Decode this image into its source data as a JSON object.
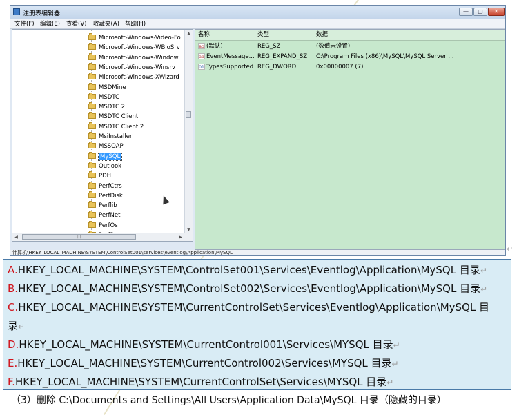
{
  "window": {
    "title": "注册表编辑器",
    "menu": [
      "文件(F)",
      "编辑(E)",
      "查看(V)",
      "收藏夹(A)",
      "帮助(H)"
    ]
  },
  "tree": {
    "items": [
      {
        "label": "Microsoft-Windows-Video-Fo",
        "selected": false
      },
      {
        "label": "Microsoft-Windows-WBioSrv",
        "selected": false
      },
      {
        "label": "Microsoft-Windows-Window",
        "selected": false
      },
      {
        "label": "Microsoft-Windows-Winsrv",
        "selected": false
      },
      {
        "label": "Microsoft-Windows-XWizard",
        "selected": false
      },
      {
        "label": "MSDMine",
        "selected": false
      },
      {
        "label": "MSDTC",
        "selected": false
      },
      {
        "label": "MSDTC 2",
        "selected": false
      },
      {
        "label": "MSDTC Client",
        "selected": false
      },
      {
        "label": "MSDTC Client 2",
        "selected": false
      },
      {
        "label": "MsiInstaller",
        "selected": false
      },
      {
        "label": "MSSOAP",
        "selected": false
      },
      {
        "label": "MySQL",
        "selected": true
      },
      {
        "label": "Outlook",
        "selected": false
      },
      {
        "label": "PDH",
        "selected": false
      },
      {
        "label": "PerfCtrs",
        "selected": false
      },
      {
        "label": "PerfDisk",
        "selected": false
      },
      {
        "label": "Perflib",
        "selected": false
      },
      {
        "label": "PerfNet",
        "selected": false
      },
      {
        "label": "PerfOs",
        "selected": false
      },
      {
        "label": "PerfProc",
        "selected": false
      }
    ]
  },
  "values_pane": {
    "headers": [
      "名称",
      "类型",
      "数据"
    ],
    "rows": [
      {
        "icon": "ab",
        "name": "(默认)",
        "type": "REG_SZ",
        "data": "(数值未设置)"
      },
      {
        "icon": "ab",
        "name": "EventMessage...",
        "type": "REG_EXPAND_SZ",
        "data": "C:\\Program Files (x86)\\MySQL\\MySQL Server ..."
      },
      {
        "icon": "binary",
        "name": "TypesSupported",
        "type": "REG_DWORD",
        "data": "0x00000007 (7)"
      }
    ]
  },
  "status_path": "计算机\\HKEY_LOCAL_MACHINE\\SYSTEM\\ControlSet001\\services\\eventlog\\Application\\MySQL",
  "options": [
    {
      "letter": "A.",
      "text": "HKEY_LOCAL_MACHINE\\SYSTEM\\ControlSet001\\Services\\Eventlog\\Application\\MySQL  目录"
    },
    {
      "letter": "B.",
      "text": "HKEY_LOCAL_MACHINE\\SYSTEM\\ControlSet002\\Services\\Eventlog\\Application\\MySQL  目录"
    },
    {
      "letter": "C.",
      "text": "HKEY_LOCAL_MACHINE\\SYSTEM\\CurrentControlSet\\Services\\Eventlog\\Application\\MySQL   目"
    },
    {
      "letter": "",
      "text": "录"
    },
    {
      "letter": "D.",
      "text": "HKEY_LOCAL_MACHINE\\SYSTEM\\CurrentControl001\\Services\\MYSQL  目录"
    },
    {
      "letter": "E.",
      "text": "HKEY_LOCAL_MACHINE\\SYSTEM\\CurrentControl002\\Services\\MYSQL   目录"
    },
    {
      "letter": "F.",
      "text": "HKEY_LOCAL_MACHINE\\SYSTEM\\CurrentControlSet\\Services\\MYSQL   目录"
    }
  ],
  "footer": "（3）删除 C:\\Documents and Settings\\All Users\\Application Data\\MySQL 目录（隐藏的目录）",
  "icons": {
    "folder": "folder-icon",
    "string_value": "string-value-icon",
    "binary_value": "binary-value-icon"
  },
  "colors": {
    "values_bg": "#c7e8cd",
    "answer_bg": "#d9ecf5",
    "option_letter": "#d0141c",
    "selection": "#3399ff"
  }
}
